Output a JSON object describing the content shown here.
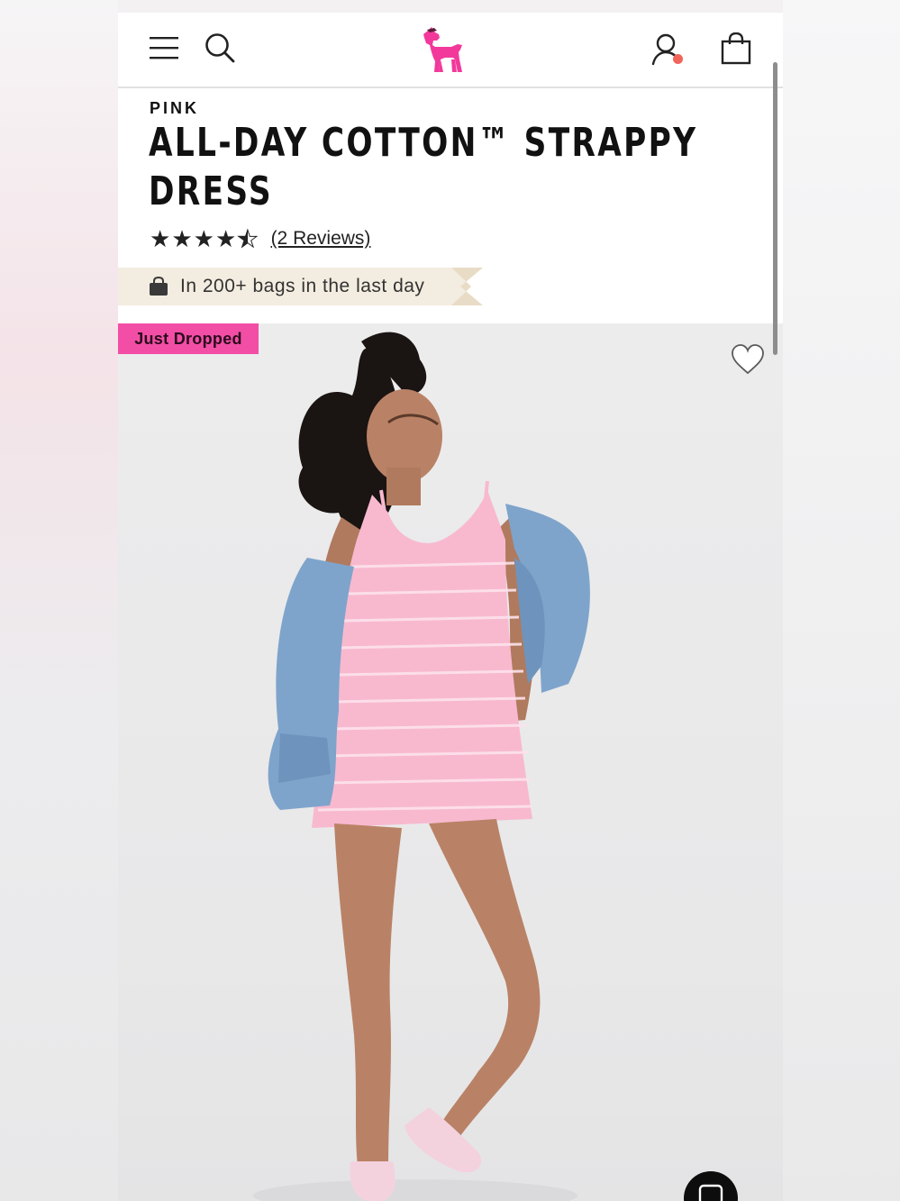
{
  "header": {
    "menu_icon": "hamburger-menu-icon",
    "search_icon": "search-icon",
    "logo_icon": "pink-dog-logo-icon",
    "account_icon": "account-icon",
    "bag_icon": "shopping-bag-icon",
    "logo_color": "#f2399b",
    "notification_dot_color": "#f0645a"
  },
  "product": {
    "brand": "PINK",
    "title": "ALL-DAY COTTON™ STRAPPY DRESS",
    "rating": 4.5,
    "rating_max": 5,
    "reviews_label": "(2 Reviews)"
  },
  "social_proof": {
    "icon": "shopping-bag-icon",
    "text": "In 200+ bags in the last day",
    "banner_color": "#f3ece0"
  },
  "image": {
    "badge": "Just Dropped",
    "badge_color": "#f34ea6",
    "wishlist_icon": "heart-outline-icon",
    "description_icon": "product-photo"
  },
  "chat": {
    "icon": "chat-icon"
  }
}
